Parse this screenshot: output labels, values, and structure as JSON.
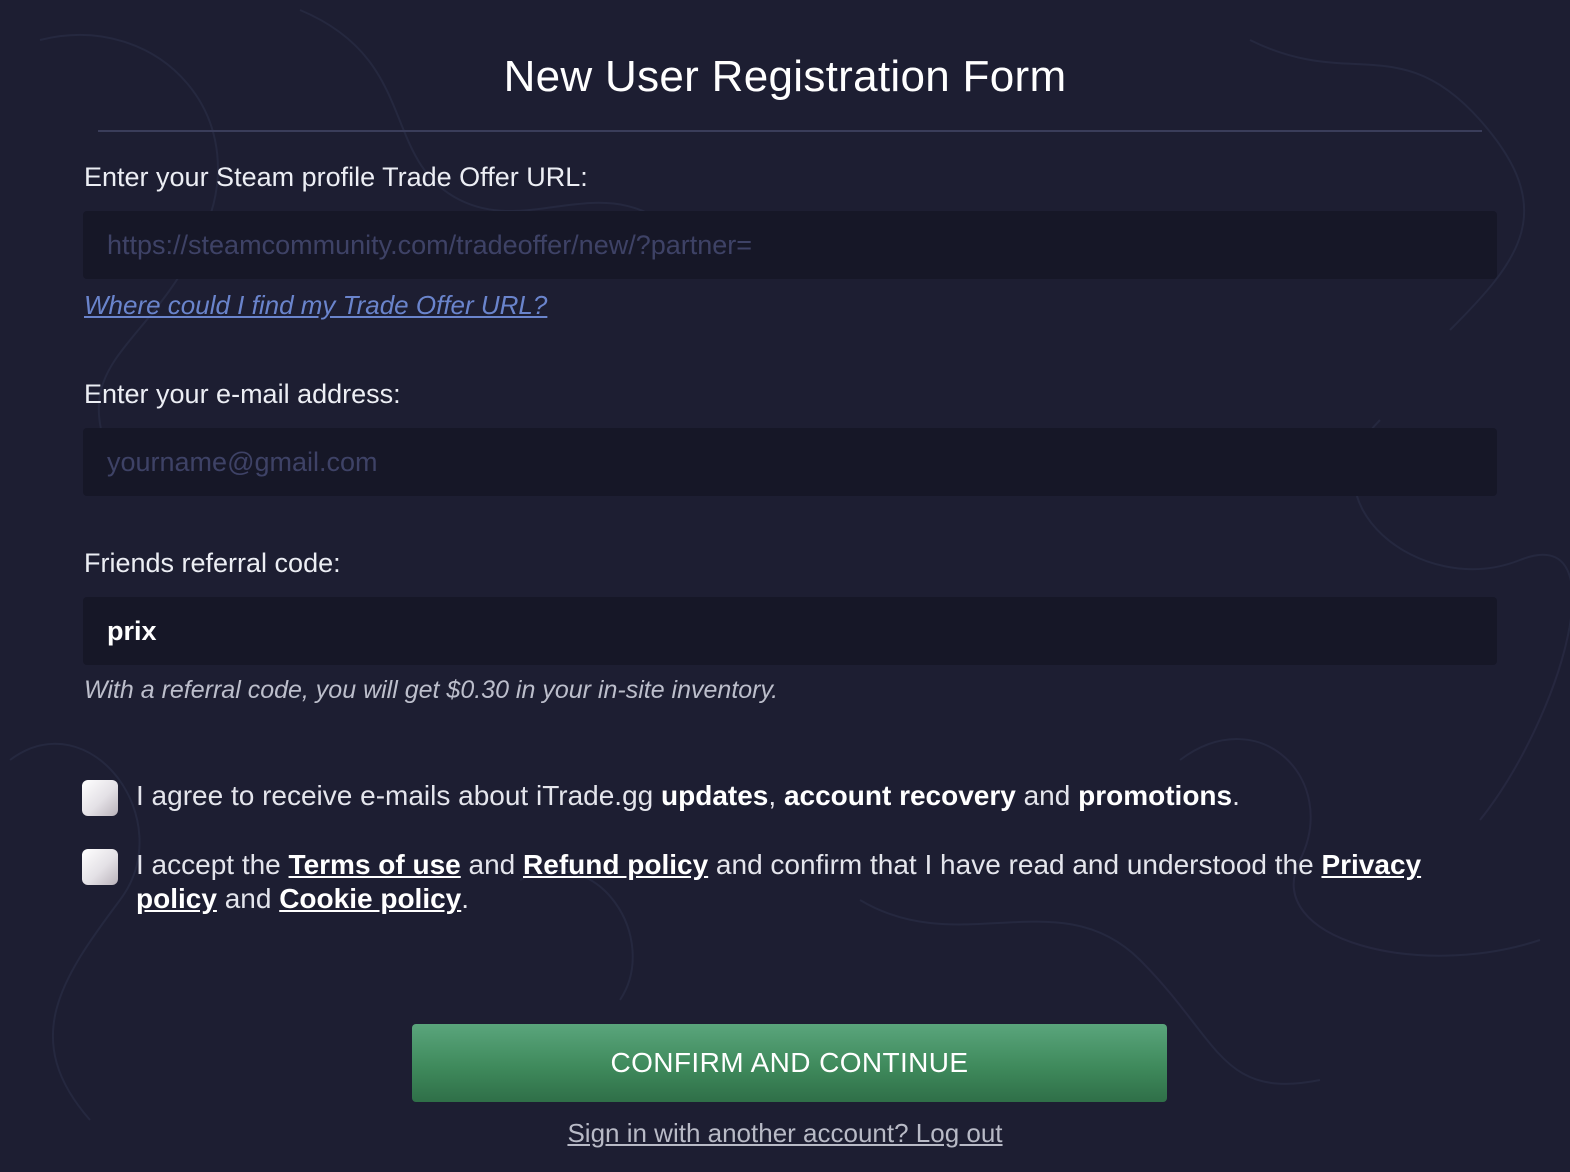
{
  "form": {
    "title": "New User Registration Form",
    "trade_url": {
      "label": "Enter your Steam profile Trade Offer URL:",
      "placeholder": "https://steamcommunity.com/tradeoffer/new/?partner=",
      "value": "",
      "help_link": "Where could I find my Trade Offer URL?"
    },
    "email": {
      "label": "Enter your e-mail address:",
      "placeholder": "yourname@gmail.com",
      "value": ""
    },
    "referral": {
      "label": "Friends referral code:",
      "value": "prix",
      "note": "With a referral code, you will get $0.30 in your in-site inventory."
    },
    "consent_emails": {
      "checked": false,
      "text_before": "I agree to receive e-mails about iTrade.gg ",
      "bold_1": "updates",
      "sep_1": ", ",
      "bold_2": "account recovery",
      "sep_2": " and ",
      "bold_3": "promotions",
      "end": "."
    },
    "consent_terms": {
      "checked": false,
      "text_1": "I accept the ",
      "link_terms": "Terms of use",
      "text_2": " and ",
      "link_refund": "Refund policy",
      "text_3": " and confirm that I have read and understood the ",
      "link_privacy": "Privacy policy",
      "text_4": " and ",
      "link_cookie": "Cookie policy",
      "end": "."
    },
    "confirm_button": "CONFIRM AND CONTINUE",
    "logout_link": "Sign in with another account? Log out"
  },
  "colors": {
    "background": "#1d1e32",
    "input_background": "#161727",
    "help_link": "#6a84cc",
    "button_green": "#3f8a5c"
  }
}
